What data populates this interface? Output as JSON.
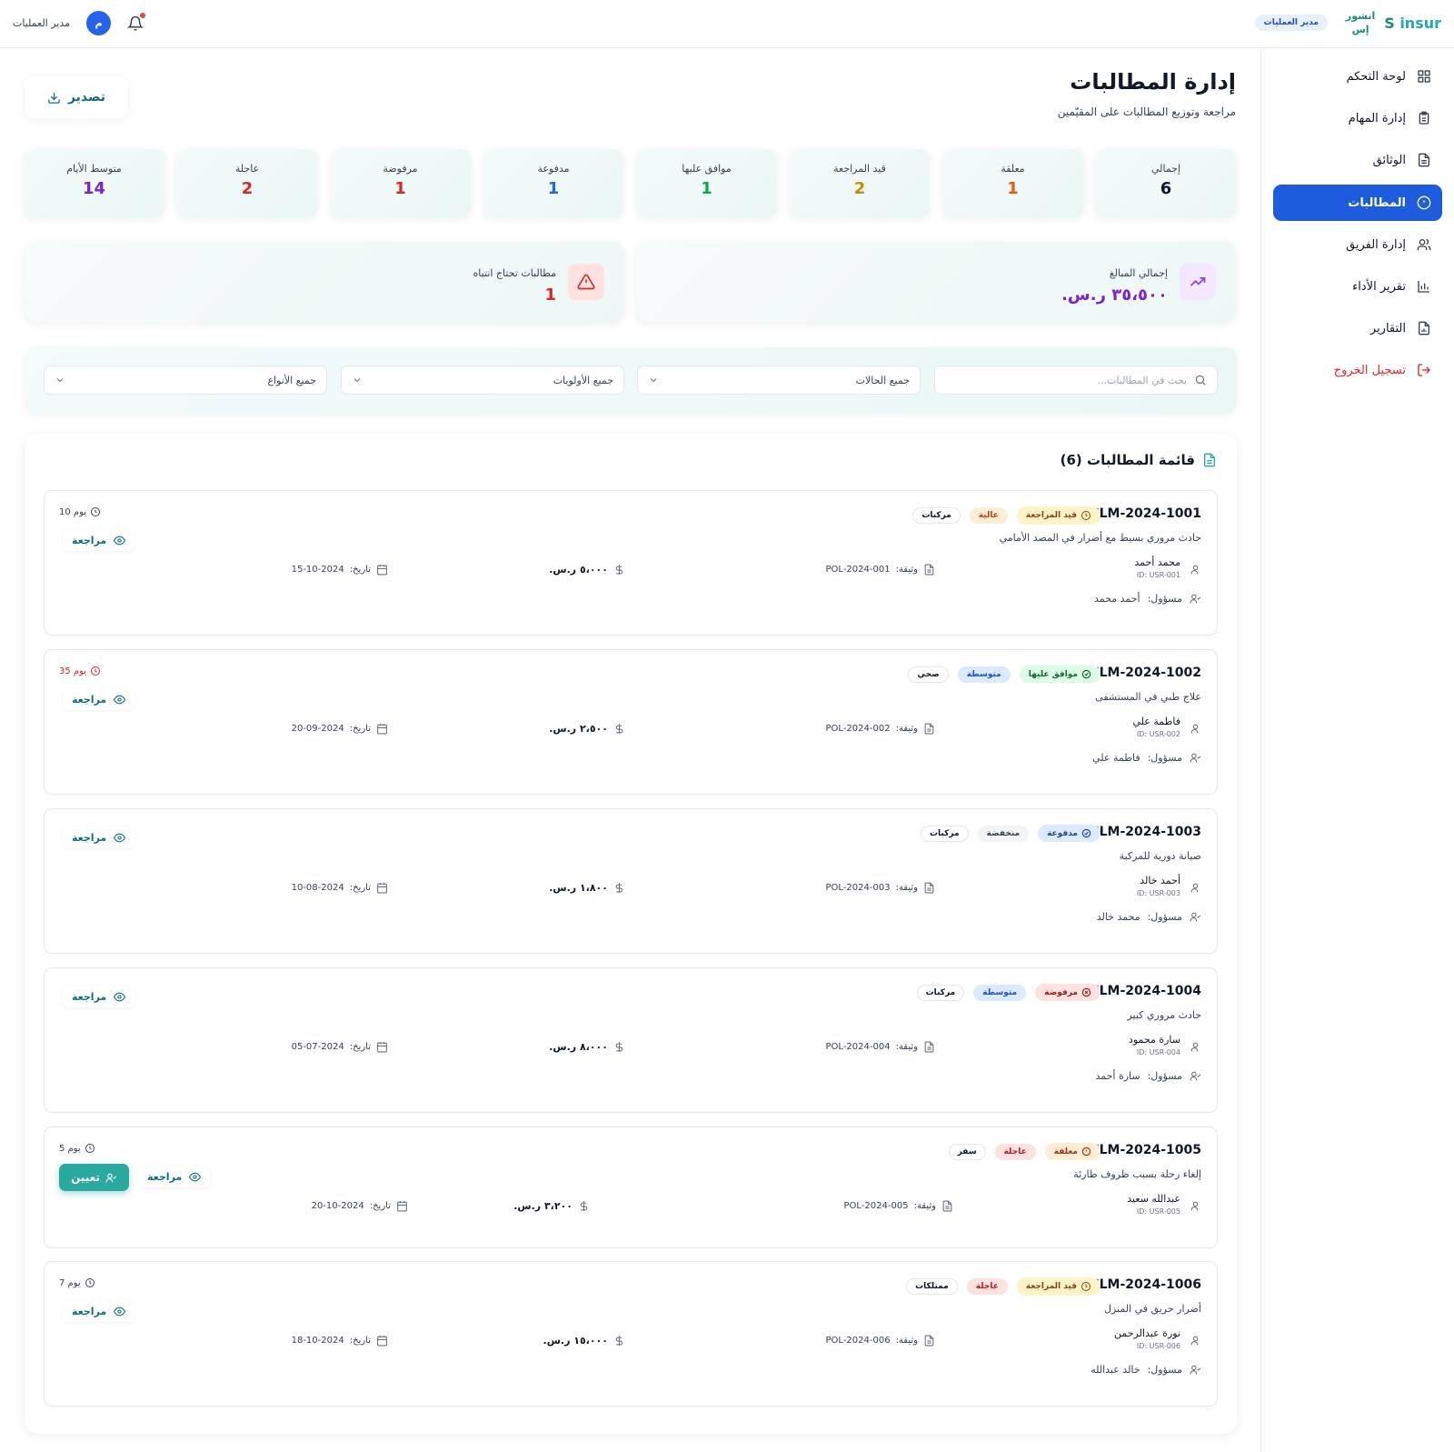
{
  "brand": {
    "name_en": "insur",
    "name_ar_line1": "انشور",
    "name_ar_line2": "إس",
    "role": "مدير العمليات"
  },
  "user": {
    "name": "مدير العمليات",
    "avatar_letter": "م"
  },
  "sidebar": {
    "items": [
      {
        "label": "لوحة التحكم",
        "icon": "dashboard-icon"
      },
      {
        "label": "إدارة المهام",
        "icon": "tasks-icon"
      },
      {
        "label": "الوثائق",
        "icon": "document-icon"
      },
      {
        "label": "المطالبات",
        "icon": "alert-circle-icon",
        "active": true
      },
      {
        "label": "إدارة الفريق",
        "icon": "users-icon"
      },
      {
        "label": "تقرير الأداء",
        "icon": "bar-chart-icon"
      },
      {
        "label": "التقارير",
        "icon": "report-icon"
      },
      {
        "label": "تسجيل الخروج",
        "icon": "logout-icon"
      }
    ]
  },
  "page": {
    "title": "إدارة المطالبات",
    "subtitle": "مراجعة وتوزيع المطالبات على المقيّمين",
    "export_label": "تصدير"
  },
  "stats": [
    {
      "label": "إجمالي",
      "value": "6",
      "color": "#111827"
    },
    {
      "label": "معلقة",
      "value": "1",
      "color": "#ea580c"
    },
    {
      "label": "قيد المراجعة",
      "value": "2",
      "color": "#ca8a04"
    },
    {
      "label": "موافق عليها",
      "value": "1",
      "color": "#16a34a"
    },
    {
      "label": "مدفوعة",
      "value": "1",
      "color": "#2563eb"
    },
    {
      "label": "مرفوضة",
      "value": "1",
      "color": "#dc2626"
    },
    {
      "label": "عاجلة",
      "value": "2",
      "color": "#dc2626"
    },
    {
      "label": "متوسط الأيام",
      "value": "14",
      "color": "#7e22ce"
    }
  ],
  "summary": {
    "total_amount_label": "إجمالي المبالغ",
    "total_amount_value": "٣٥،٥٠٠ ر.س.",
    "attention_label": "مطالبات تحتاج انتباه",
    "attention_value": "1"
  },
  "filters": {
    "search_placeholder": "بحث في المطالبات...",
    "status": "جميع الحالات",
    "priority": "جميع الأولويات",
    "type": "جميع الأنواع"
  },
  "claims_list": {
    "title": "قائمة المطالبات (6)",
    "review_label": "مراجعة",
    "assign_label": "تعيين",
    "policy_prefix": "وثيقة:",
    "date_prefix": "تاريخ:",
    "handler_prefix": "مسؤول:",
    "items": [
      {
        "id": "CLM-2024-1001",
        "status": "قيد المراجعة",
        "priority": "عالية",
        "type": "مركبات",
        "desc": "حادث مروري بسيط مع أضرار في المصد الأمامي",
        "claimant": "محمد أحمد",
        "claimant_id": "ID: USR-001",
        "policy": "POL-2024-001",
        "amount": "٥،٠٠٠ ر.س.",
        "date": "15-10-2024",
        "handler": "أحمد محمد",
        "days": "10 يوم"
      },
      {
        "id": "CLM-2024-1002",
        "status": "موافق عليها",
        "priority": "متوسطة",
        "type": "صحي",
        "desc": "علاج طبي في المستشفى",
        "claimant": "فاطمة علي",
        "claimant_id": "ID: USR-002",
        "policy": "POL-2024-002",
        "amount": "٢،٥٠٠ ر.س.",
        "date": "20-09-2024",
        "handler": "فاطمة علي",
        "days": "35 يوم"
      },
      {
        "id": "CLM-2024-1003",
        "status": "مدفوعة",
        "priority": "منخفضة",
        "type": "مركبات",
        "desc": "صيانة دورية للمركبة",
        "claimant": "أحمد خالد",
        "claimant_id": "ID: USR-003",
        "policy": "POL-2024-003",
        "amount": "١،٨٠٠ ر.س.",
        "date": "10-08-2024",
        "handler": "محمد خالد"
      },
      {
        "id": "CLM-2024-1004",
        "status": "مرفوضة",
        "priority": "متوسطة",
        "type": "مركبات",
        "desc": "حادث مروري كبير",
        "claimant": "سارة محمود",
        "claimant_id": "ID: USR-004",
        "policy": "POL-2024-004",
        "amount": "٨،٠٠٠ ر.س.",
        "date": "05-07-2024",
        "handler": "سارة أحمد"
      },
      {
        "id": "CLM-2024-1005",
        "status": "معلقة",
        "priority": "عاجلة",
        "type": "سفر",
        "desc": "إلغاء رحلة بسبب ظروف طارئة",
        "claimant": "عبدالله سعيد",
        "claimant_id": "ID: USR-005",
        "policy": "POL-2024-005",
        "amount": "٣،٢٠٠ ر.س.",
        "date": "20-10-2024",
        "days": "5 يوم"
      },
      {
        "id": "CLM-2024-1006",
        "status": "قيد المراجعة",
        "priority": "عاجلة",
        "type": "ممتلكات",
        "desc": "أضرار حريق في المنزل",
        "claimant": "نورة عبدالرحمن",
        "claimant_id": "ID: USR-006",
        "policy": "POL-2024-006",
        "amount": "١٥،٠٠٠ ر.س.",
        "date": "18-10-2024",
        "handler": "خالد عبدالله",
        "days": "7 يوم"
      }
    ]
  }
}
